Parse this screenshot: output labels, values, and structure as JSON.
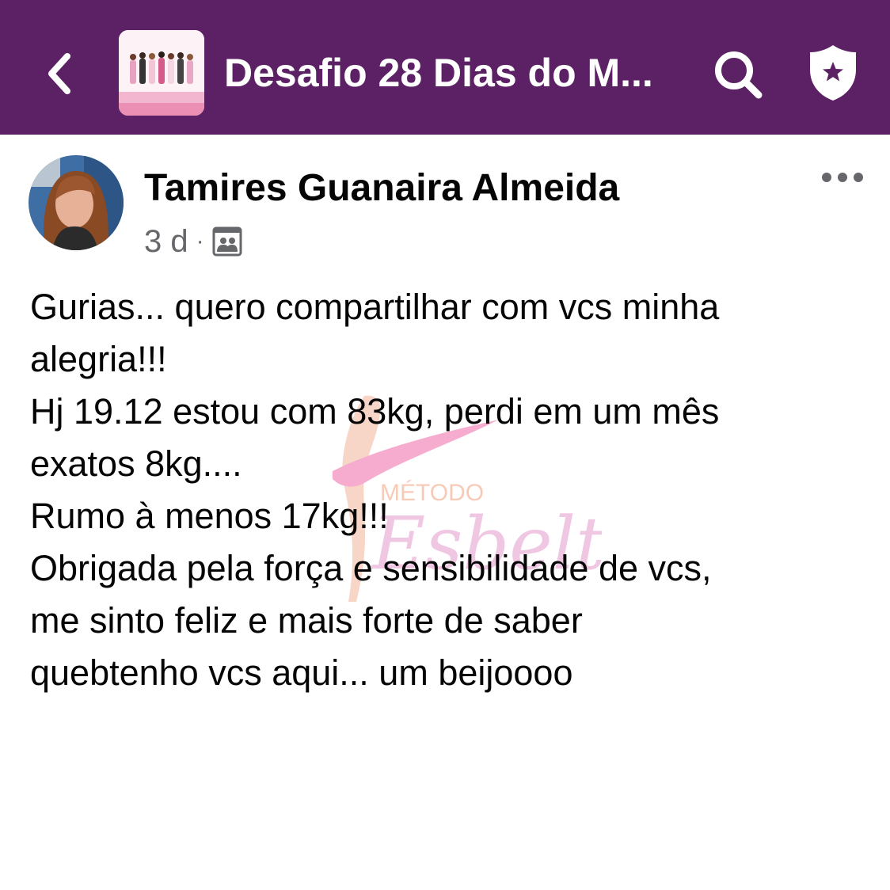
{
  "header": {
    "group_title": "Desafio 28 Dias do M...",
    "back_icon": "chevron-left-icon",
    "search_icon": "search-icon",
    "admin_icon": "shield-star-icon",
    "bar_color": "#5c2165"
  },
  "post": {
    "author": "Tamires Guanaira Almeida",
    "time": "3 d",
    "separator": "·",
    "audience_icon": "group-privacy-icon",
    "more_icon": "more-horizontal-icon",
    "lines": [
      "Gurias... quero compartilhar com vcs minha",
      "alegria!!!",
      "Hj 19.12 estou com 83kg, perdi em um mês",
      "exatos 8kg....",
      "Rumo à  menos 17kg!!!",
      "Obrigada pela força e sensibilidade de vcs,",
      "me sinto feliz e mais forte de saber",
      "quebtenho vcs aqui... um beijoooo"
    ]
  },
  "watermark": {
    "top_text": "MÉTODO",
    "script_text": "Esbelta"
  }
}
